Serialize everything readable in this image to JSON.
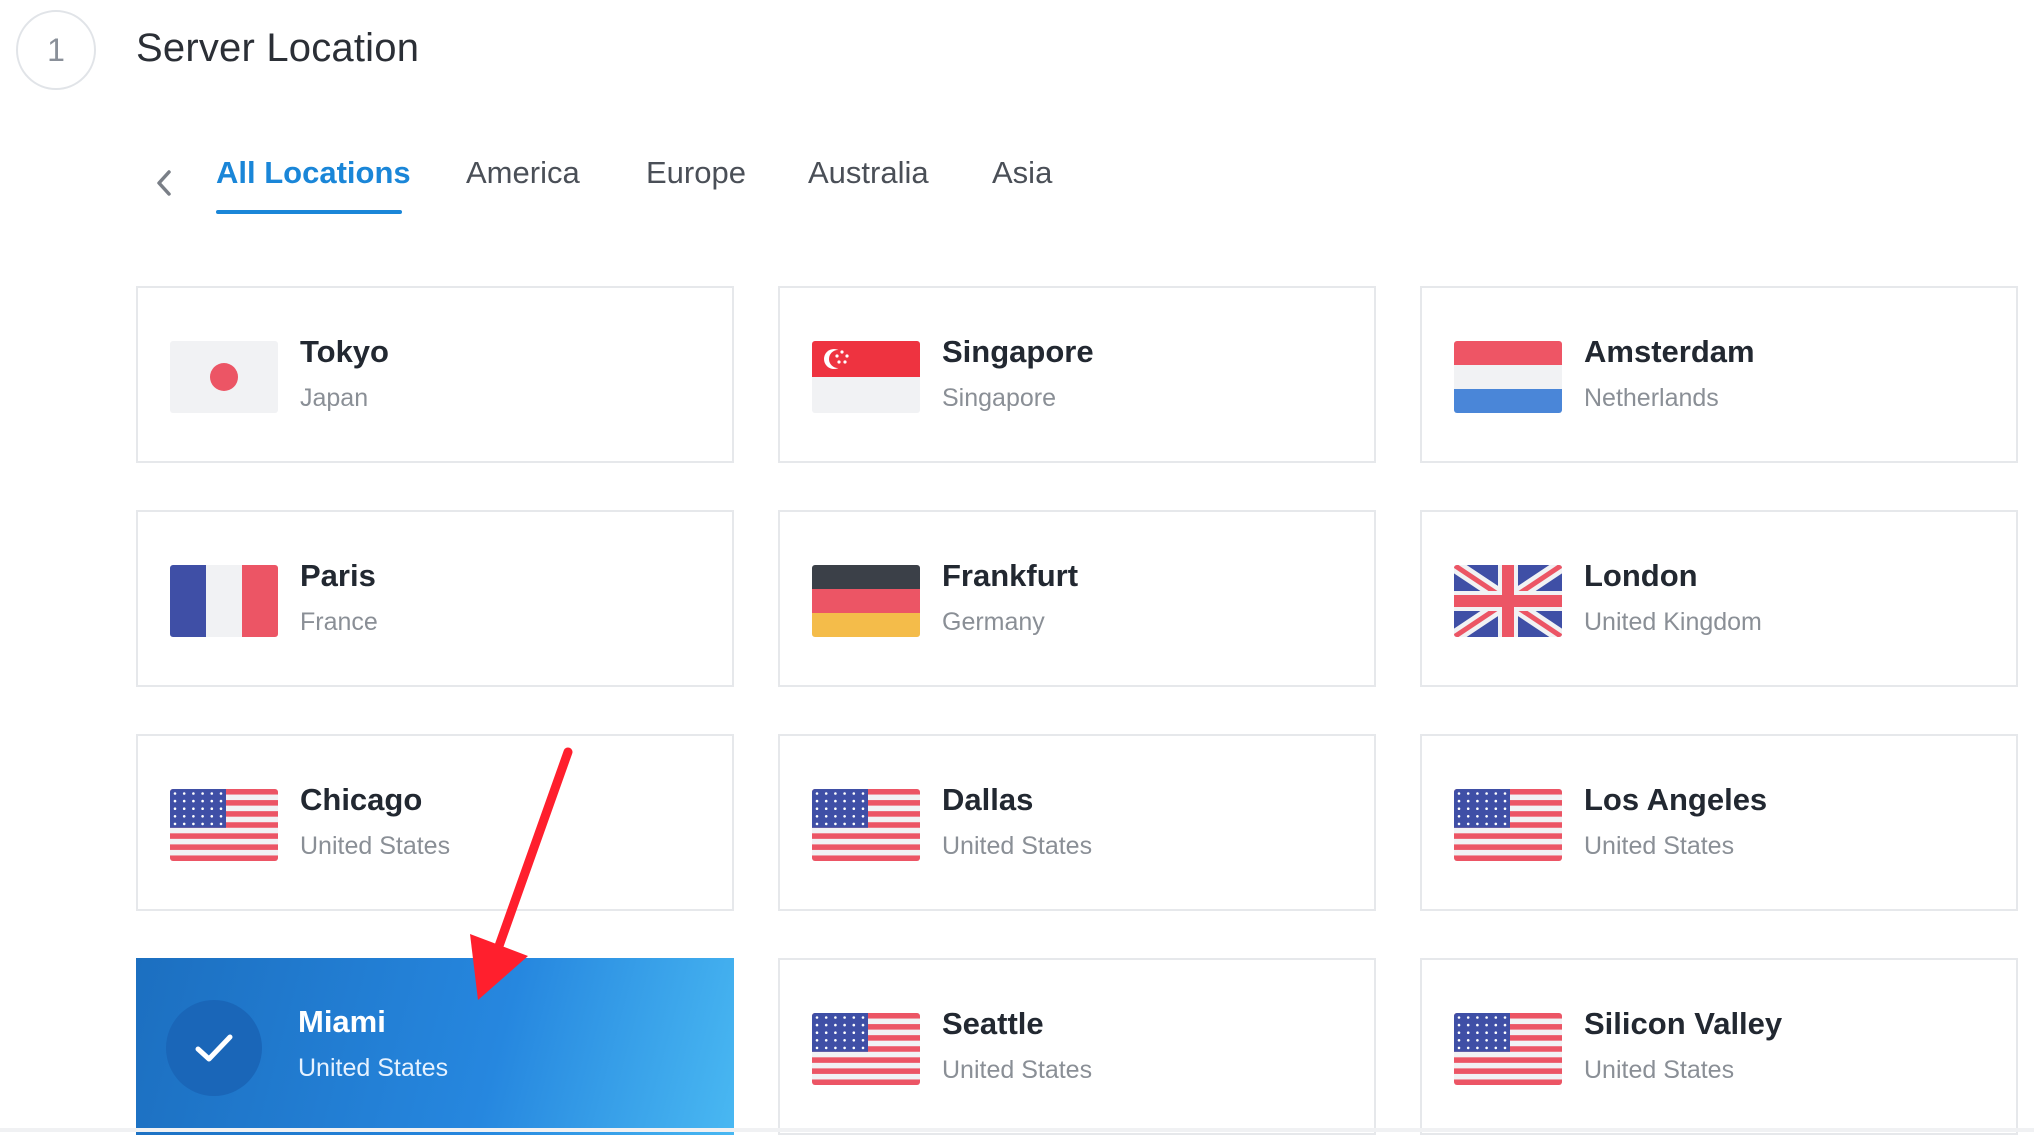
{
  "header": {
    "step_number": "1",
    "title": "Server Location"
  },
  "tabs": [
    {
      "label": "All Locations",
      "active": true
    },
    {
      "label": "America",
      "active": false
    },
    {
      "label": "Europe",
      "active": false
    },
    {
      "label": "Australia",
      "active": false
    },
    {
      "label": "Asia",
      "active": false
    }
  ],
  "locations": [
    {
      "city": "Tokyo",
      "country": "Japan",
      "flag": "japan-flag-icon"
    },
    {
      "city": "Singapore",
      "country": "Singapore",
      "flag": "singapore-flag-icon"
    },
    {
      "city": "Amsterdam",
      "country": "Netherlands",
      "flag": "netherlands-flag-icon"
    },
    {
      "city": "Paris",
      "country": "France",
      "flag": "france-flag-icon"
    },
    {
      "city": "Frankfurt",
      "country": "Germany",
      "flag": "germany-flag-icon"
    },
    {
      "city": "London",
      "country": "United Kingdom",
      "flag": "uk-flag-icon"
    },
    {
      "city": "Chicago",
      "country": "United States",
      "flag": "us-flag-icon"
    },
    {
      "city": "Dallas",
      "country": "United States",
      "flag": "us-flag-icon"
    },
    {
      "city": "Los Angeles",
      "country": "United States",
      "flag": "us-flag-icon"
    },
    {
      "city": "Miami",
      "country": "United States",
      "flag": "check-icon",
      "selected": true
    },
    {
      "city": "Seattle",
      "country": "United States",
      "flag": "us-flag-icon"
    },
    {
      "city": "Silicon Valley",
      "country": "United States",
      "flag": "us-flag-icon"
    }
  ],
  "colors": {
    "accent": "#1a86d8",
    "selected_start": "#1c6fc0",
    "selected_end": "#49b8f2",
    "annotation_arrow": "#ff1f2d"
  }
}
